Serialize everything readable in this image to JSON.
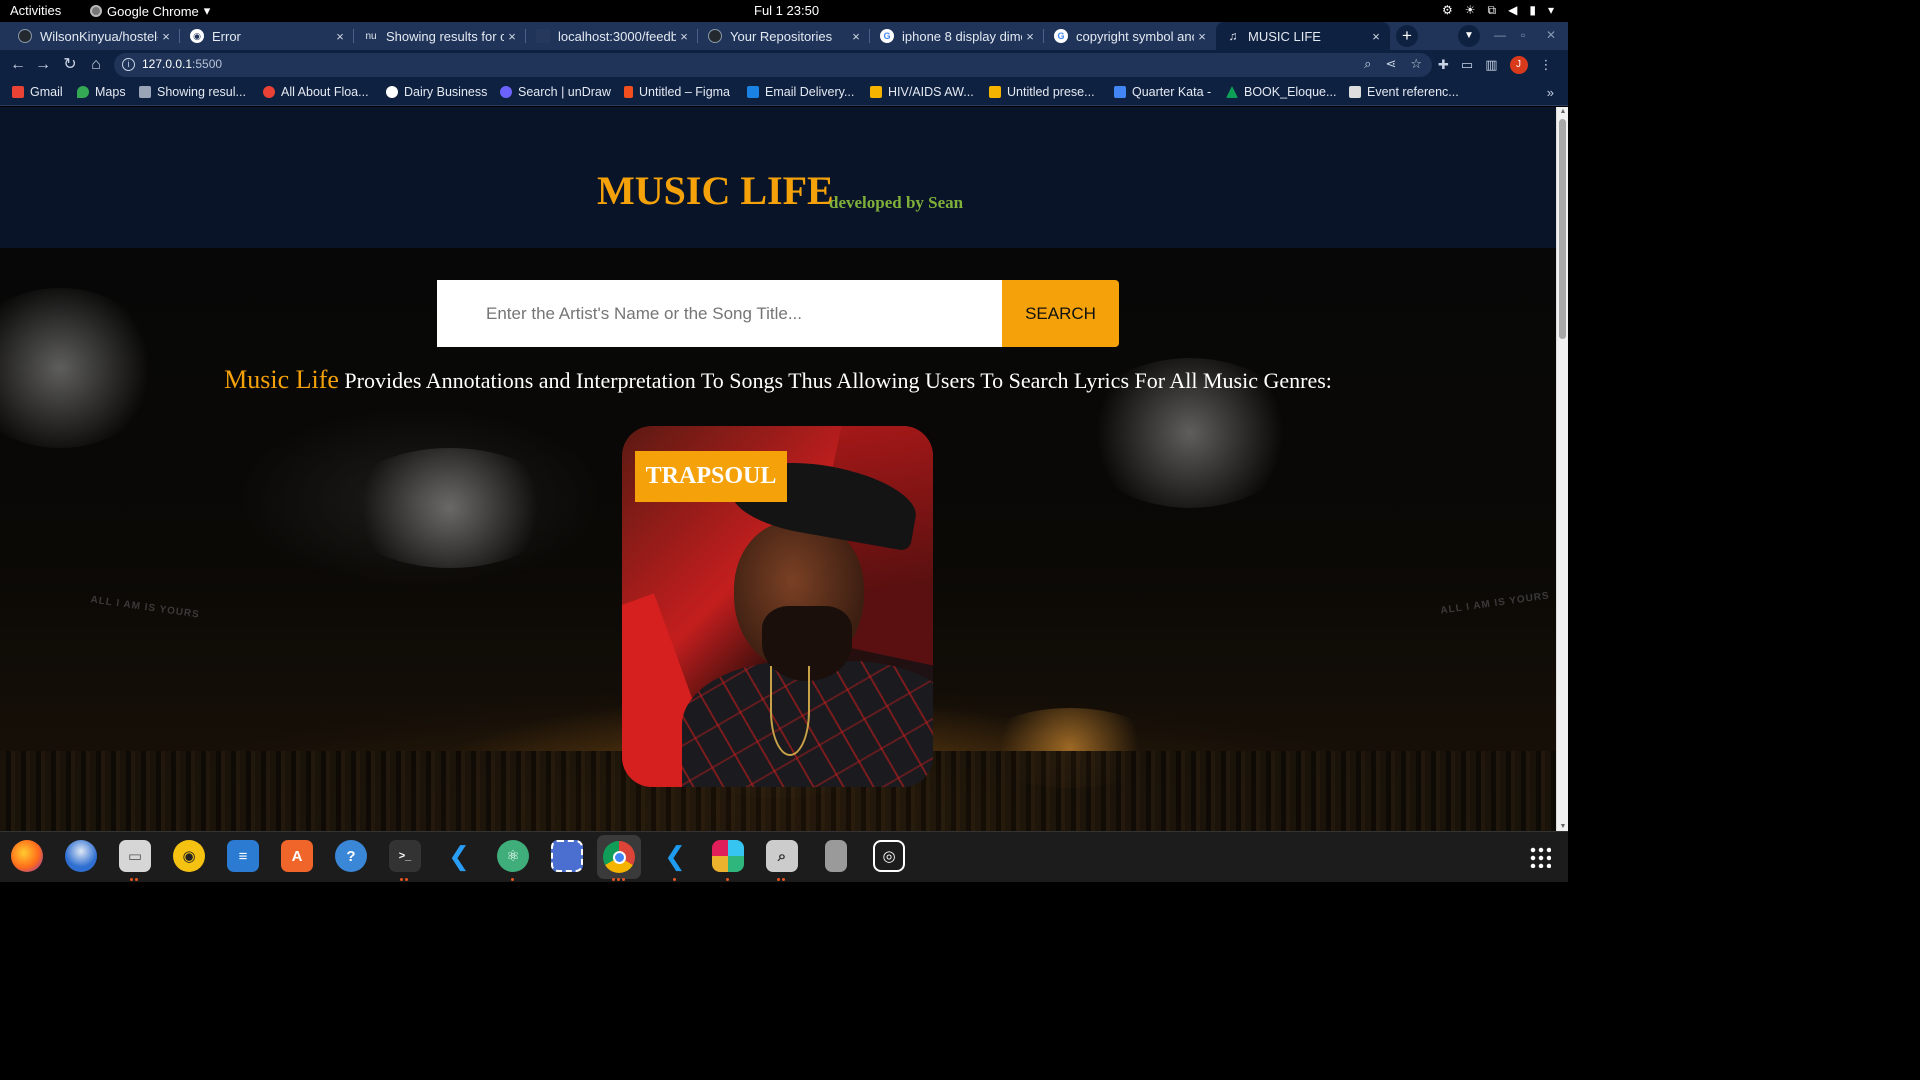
{
  "system": {
    "activities": "Activities",
    "app_name": "Google Chrome",
    "app_menu_arrow": "▾",
    "clock": "Ful 1  23:50"
  },
  "browser": {
    "tabs": [
      {
        "title": "WilsonKinyua/hostel-",
        "icon": "github-icon",
        "active": false
      },
      {
        "title": "Error",
        "icon": "globe-icon",
        "active": false
      },
      {
        "title": "Showing results for c",
        "icon": "nu-icon",
        "active": false
      },
      {
        "title": "localhost:3000/feedb",
        "icon": "page-icon",
        "active": false
      },
      {
        "title": "Your Repositories",
        "icon": "github-icon",
        "active": false
      },
      {
        "title": "iphone 8 display dime",
        "icon": "google-icon",
        "active": false
      },
      {
        "title": "copyright symbol anc",
        "icon": "google-icon",
        "active": false
      },
      {
        "title": "MUSIC LIFE",
        "icon": "music-note-icon",
        "active": true
      }
    ],
    "tab_close_glyph": "×",
    "new_tab_glyph": "+",
    "url_host": "127.0.0.1",
    "url_port": ":5500",
    "profile_initial": "J",
    "bookmarks": [
      {
        "label": "Gmail",
        "color": "#ea4335"
      },
      {
        "label": "Maps",
        "color": "#34a853"
      },
      {
        "label": "Showing resul...",
        "color": "#9aa5b8"
      },
      {
        "label": "All About Floa...",
        "color": "#e94235"
      },
      {
        "label": "Dairy Business",
        "color": "#ffffff"
      },
      {
        "label": "Search | unDraw",
        "color": "#6c63ff"
      },
      {
        "label": "Untitled – Figma",
        "color": "#f24e1e"
      },
      {
        "label": "Email Delivery...",
        "color": "#1a82e2"
      },
      {
        "label": "HIV/AIDS AW...",
        "color": "#f4b400"
      },
      {
        "label": "Untitled prese...",
        "color": "#f4b400"
      },
      {
        "label": "Quarter Kata -",
        "color": "#4285f4"
      },
      {
        "label": "BOOK_Eloque...",
        "color": "#0f9d58"
      },
      {
        "label": "Event referenc...",
        "color": "#222222"
      }
    ],
    "bookmarks_more": "»"
  },
  "page": {
    "title": "MUSIC LIFE",
    "subtitle": "developed by Sean",
    "search": {
      "placeholder": "Enter the Artist's Name or the Song Title...",
      "value": "",
      "button_label": "SEARCH"
    },
    "tagline": {
      "brand": "Music Life",
      "text": " Provides Annotations and Interpretation To Songs Thus Allowing Users To Search Lyrics For All Music Genres:"
    },
    "featured_card": {
      "badge": "TRAPSOUL"
    },
    "background_text": [
      "ALL I AM IS YOURS",
      "ALL I AM IS YOURS"
    ]
  },
  "colors": {
    "accent": "#f5a20a",
    "subtitle_green": "#7fb03a",
    "header_bg": "#0a1428",
    "chrome_frame": "#1f3458",
    "chrome_toolbar": "#0f2140"
  },
  "dock": {
    "apps": [
      {
        "name": "firefox-icon",
        "running": false
      },
      {
        "name": "thunderbird-icon",
        "running": false
      },
      {
        "name": "files-icon",
        "running": true
      },
      {
        "name": "rhythmbox-icon",
        "running": false
      },
      {
        "name": "libreoffice-writer-icon",
        "running": false
      },
      {
        "name": "software-center-icon",
        "running": false
      },
      {
        "name": "help-icon",
        "running": false
      },
      {
        "name": "terminal-icon",
        "running": true
      },
      {
        "name": "vscode-icon",
        "running": false
      },
      {
        "name": "atom-icon",
        "running": true
      },
      {
        "name": "screenshot-tool-icon",
        "running": false
      },
      {
        "name": "chrome-icon",
        "running": true
      },
      {
        "name": "vscode-insiders-icon",
        "running": true
      },
      {
        "name": "slack-icon",
        "running": true
      },
      {
        "name": "image-viewer-icon",
        "running": true
      },
      {
        "name": "phone-icon",
        "running": false
      },
      {
        "name": "camera-icon",
        "running": false
      }
    ]
  }
}
